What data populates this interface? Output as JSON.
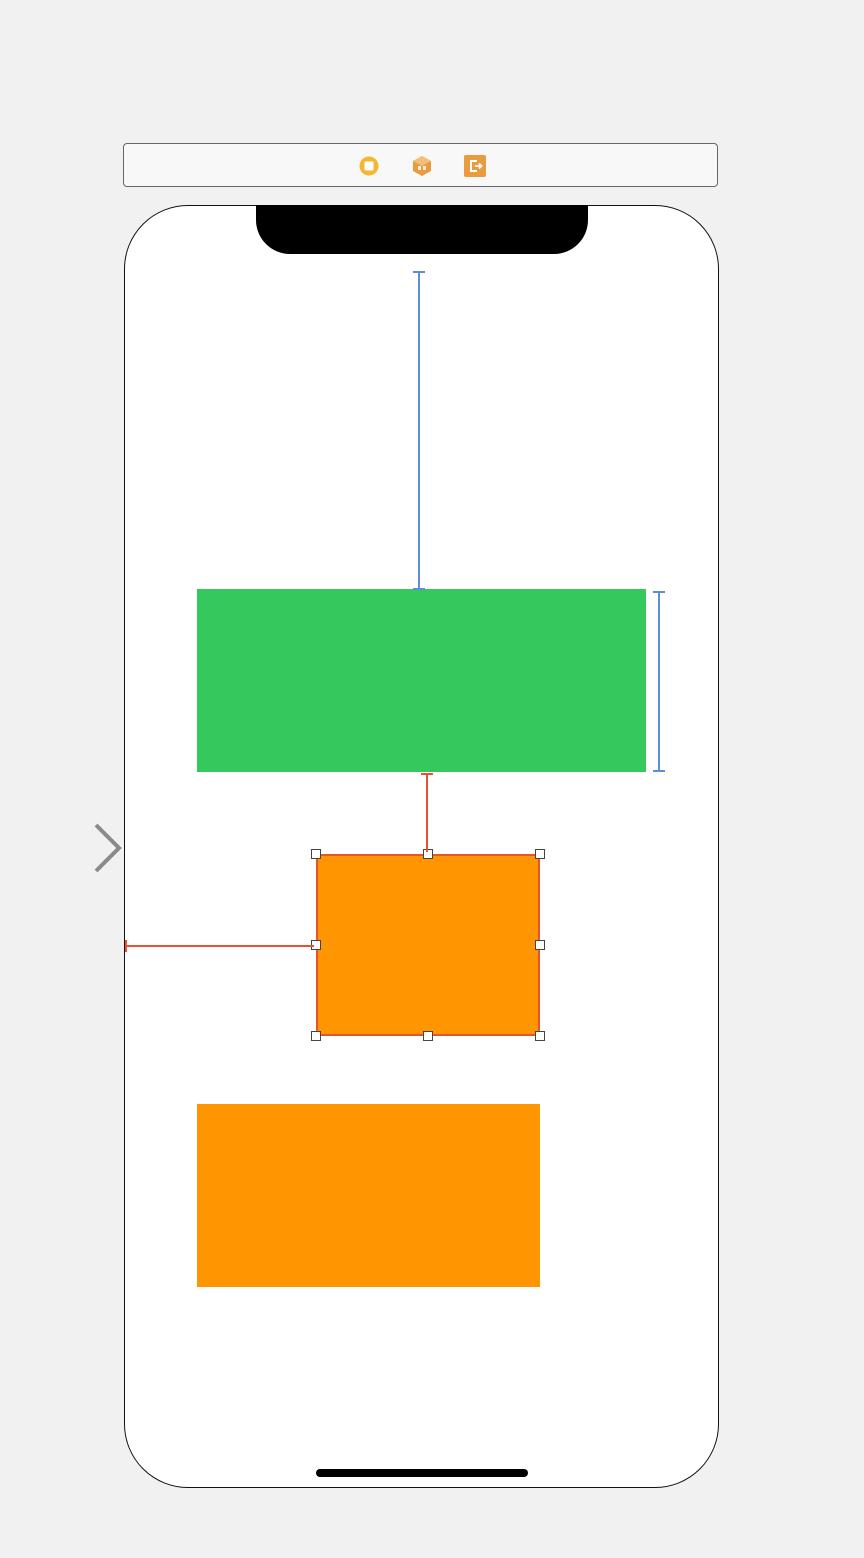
{
  "scene_dock": {
    "icons": [
      {
        "name": "view-controller-icon",
        "color": "#f5b731"
      },
      {
        "name": "first-responder-icon",
        "color": "#ea9a3f"
      },
      {
        "name": "exit-icon",
        "color": "#ea9a3f"
      }
    ]
  },
  "colors": {
    "canvas_background": "#f1f1f1",
    "device_background": "#ffffff",
    "green_view": "#35c95d",
    "orange_view": "#ff9500",
    "constraint_blue": "#5b8fd6",
    "constraint_red": "#e8522e",
    "selection_border": "#e8522e",
    "entry_arrow": "#8a8a8a"
  },
  "canvas": {
    "initial_view_controller_arrow": true,
    "selected_view": "orange-view-selected"
  }
}
